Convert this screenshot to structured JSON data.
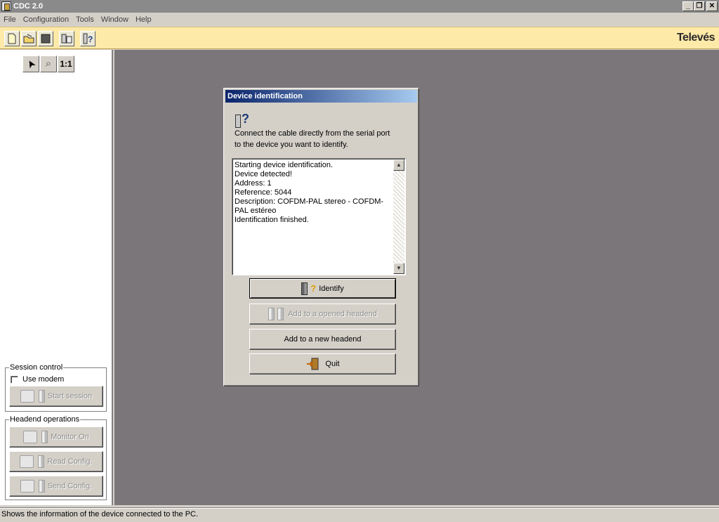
{
  "window": {
    "title": "CDC 2.0",
    "minimize_glyph": "_",
    "restore_glyph": "❐",
    "close_glyph": "✕"
  },
  "menu": [
    "File",
    "Configuration",
    "Tools",
    "Window",
    "Help"
  ],
  "toolbar": {
    "brand_logo": "Televés",
    "icons": [
      "new-document-icon",
      "open-folder-icon",
      "stop-icon",
      "device-list-icon",
      "device-identify-icon"
    ]
  },
  "left_tools": {
    "pointer_glyph": "➤",
    "zoom_glyph": "⌕",
    "actual_size_label": "1:1"
  },
  "session_control": {
    "legend": "Session control",
    "use_modem_label": "Use modem",
    "use_modem_checked": false,
    "start_session_label": "Start session"
  },
  "headend_operations": {
    "legend": "Headend operations",
    "monitor_on_label": "Monitor On",
    "read_config_label": "Read Config.",
    "send_config_label": "Send Config."
  },
  "dialog": {
    "title": "Device identification",
    "instruction_line1": "Connect the cable directly from the serial port",
    "instruction_line2": "to the device you want to identify.",
    "log": "Starting device identification.\nDevice detected!\nAddress: 1\nReference: 5044\nDescription: COFDM-PAL stereo - COFDM-PAL estéreo\nIdentification finished.",
    "identify_label": "Identify",
    "add_opened_label": "Add to a opened headend",
    "add_new_label": "Add to a new headend",
    "quit_label": "Quit"
  },
  "status_bar": {
    "text": "Shows the information of the device connected to the PC."
  },
  "colors": {
    "toolbar_bg": "#fde9a8",
    "mdi_bg": "#7a7679",
    "dialog_title_start": "#0a246a",
    "dialog_title_end": "#a6caf0"
  }
}
